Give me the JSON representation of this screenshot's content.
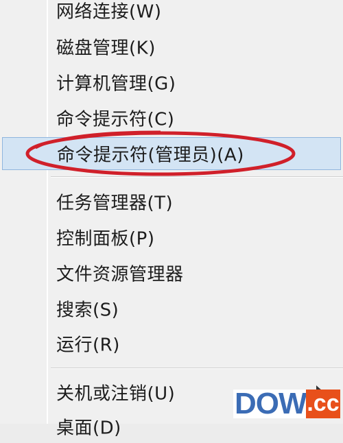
{
  "context_menu": {
    "items": [
      {
        "label": "网络连接(W)"
      },
      {
        "label": "磁盘管理(K)"
      },
      {
        "label": "计算机管理(G)"
      },
      {
        "label": "命令提示符(C)"
      },
      {
        "label": "命令提示符(管理员)(A)",
        "highlighted": true,
        "circled": true
      },
      {
        "label": "任务管理器(T)"
      },
      {
        "label": "控制面板(P)"
      },
      {
        "label": "文件资源管理器"
      },
      {
        "label": "搜索(S)"
      },
      {
        "label": "运行(R)"
      },
      {
        "label": "关机或注销(U)",
        "has_submenu": true
      },
      {
        "label": "桌面(D)"
      }
    ]
  },
  "watermark": {
    "brand": "DOWN",
    "suffix": ".cc"
  },
  "colors": {
    "highlight_fill": "#d3e4f4",
    "highlight_border": "#8fb5de",
    "annotation_ellipse": "#d0202a",
    "watermark_blue": "#3b6cb5",
    "watermark_orange": "#e8501b"
  }
}
